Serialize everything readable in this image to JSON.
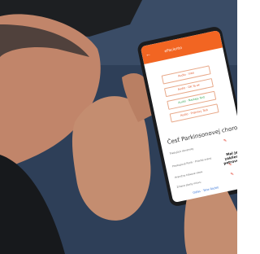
{
  "phone": {
    "status_time": "",
    "app_title": "ePaciento",
    "buttons": [
      {
        "label": "Audio · Inbo"
      },
      {
        "label": "Audio · OK Ya ek"
      },
      {
        "label": "Audio · Nastaja Test"
      },
      {
        "label": "Audio · Pripravy Test"
      }
    ],
    "section_title": "Česť Parkinsonovej choroby",
    "rows": [
      {
        "label": "Tradujúce slovensky"
      },
      {
        "label": "Prestupové Pecik - Priorita zvane"
      },
      {
        "label": "Hranične hlasove slova"
      },
      {
        "label": "Zmena zlasty mluvu"
      }
    ],
    "note": "Mal je zakliene potrovene",
    "bottom_link": "Odlas · Tahe Rozbit"
  },
  "colors": {
    "app_orange": "#f26522",
    "bg_blue_jeans": "#2c3e57",
    "skin": "#c99074"
  }
}
